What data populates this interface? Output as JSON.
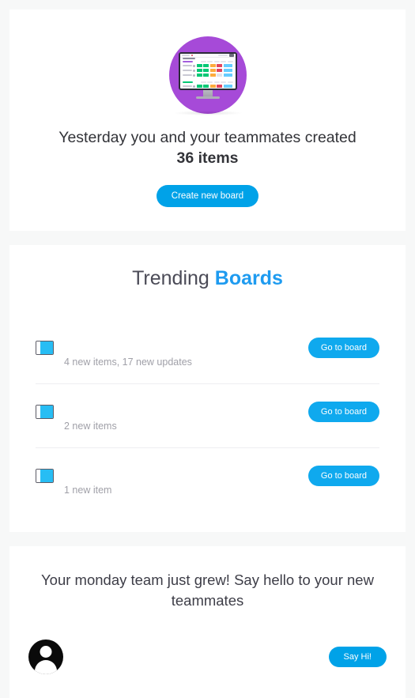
{
  "colors": {
    "page_background": "#f7f8f8",
    "card_background": "#ffffff",
    "accent_blue": "#00a2e8",
    "accent_blue_bold": "#1e9bf0",
    "board_icon_blue": "#27bdf4",
    "hero_circle_purple": "#a64ad8",
    "heading_text": "#323338",
    "muted_text": "#a0a0a8",
    "divider": "#eeeef1"
  },
  "hero": {
    "illustration_name": "desktop-monitor-board-illustration",
    "headline": "Yesterday you and your teammates created",
    "count_text": "36 items",
    "cta_label": "Create new board"
  },
  "trending": {
    "title_regular": "Trending",
    "title_accent": "Boards",
    "boards": [
      {
        "name": "",
        "meta": "4 new items, 17 new updates",
        "action_label": "Go to board"
      },
      {
        "name": "",
        "meta": "2 new items",
        "action_label": "Go to board"
      },
      {
        "name": "",
        "meta": "1 new item",
        "action_label": "Go to board"
      }
    ]
  },
  "team": {
    "title": "Your monday team just grew! Say hello to your new teammates",
    "members": [
      {
        "name": "",
        "action_label": "Say Hi!"
      }
    ]
  }
}
